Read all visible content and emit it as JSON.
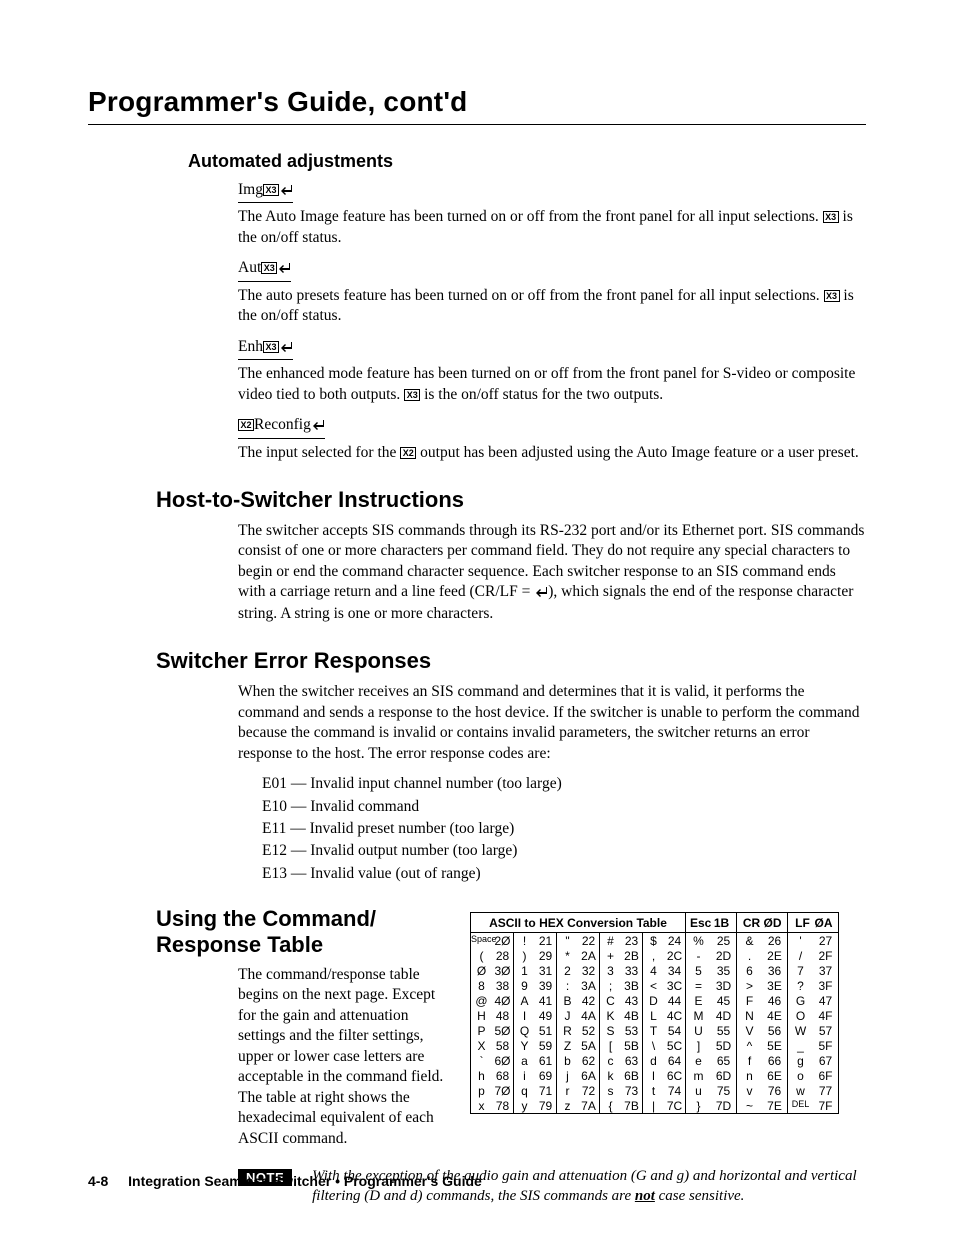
{
  "chapter_title": "Programmer's Guide, cont'd",
  "sections": {
    "automated": {
      "heading": "Automated adjustments",
      "img": {
        "label_prefix": "Img",
        "x_tag": "X3",
        "body_a": "The Auto Image feature has been turned on or off from the front panel for all input selections.  ",
        "body_b": " is the on/off status."
      },
      "aut": {
        "label_prefix": "Aut",
        "x_tag": "X3",
        "body_a": "The auto presets feature has been turned on or off from the front panel for all input selections.  ",
        "body_b": " is the on/off status."
      },
      "enh": {
        "label_prefix": "Enh",
        "x_tag": "X3",
        "body_a": "The enhanced mode feature has been turned on or off from the front panel for S-video or composite video tied to both outputs.  ",
        "body_b": " is the on/off status for the two outputs."
      },
      "reconfig": {
        "x_tag": "X2",
        "label_suffix": "Reconfig",
        "body_a": "The input selected for the ",
        "body_b": " output has been adjusted using the Auto Image feature or a user preset."
      }
    },
    "host": {
      "heading": "Host-to-Switcher Instructions",
      "body": "The switcher accepts SIS commands through its RS-232 port and/or its Ethernet port.  SIS commands consist of one or more characters per command field.  They do not require any special characters to begin or end the command character sequence.  Each switcher response to an SIS command ends with a carriage return and a line feed (CR/LF = ",
      "body_end": "), which signals the end of the response character string.  A string is one or more characters."
    },
    "errors": {
      "heading": "Switcher Error Responses",
      "body": "When the switcher receives an SIS command and determines that it is valid, it performs the command and sends a response to the host device.  If the switcher is unable to perform the command because the command is invalid or contains invalid parameters, the switcher returns an error response to the host.  The error response codes are:",
      "codes": [
        "E01 — Invalid input channel number (too large)",
        "E10 — Invalid command",
        "E11 — Invalid preset number (too large)",
        "E12 — Invalid output number (too large)",
        "E13 — Invalid value (out of range)"
      ]
    },
    "cmdresp": {
      "heading": "Using the Command/ Response Table",
      "body": "The command/response table begins on the next page.  Except for the gain and attenuation settings and the filter settings, upper or lower case letters are acceptable in the command field.  The table at right shows the hexadecimal equivalent of each ASCII command."
    }
  },
  "note": {
    "badge": "NOTE",
    "text_a": "With the exception of the audio gain and attenuation (G and g) and horizontal and vertical filtering (D and d) commands, the SIS commands are ",
    "under": "not",
    "text_b": " case sensitive."
  },
  "footer": {
    "page_num": "4-8",
    "title": "Integration Seamless Switcher • Programmer's Guide"
  },
  "chart_data": {
    "type": "table",
    "title": "ASCII to HEX  Conversion Table",
    "extra_headers": [
      {
        "ch": "Esc",
        "hex": "1B"
      },
      {
        "ch": "CR",
        "hex": "ØD"
      },
      {
        "ch": "LF",
        "hex": "ØA"
      }
    ],
    "columns": 8,
    "rows": [
      [
        [
          "Space",
          "2Ø"
        ],
        [
          "!",
          "21"
        ],
        [
          "\"",
          "22"
        ],
        [
          "#",
          "23"
        ],
        [
          "$",
          "24"
        ],
        [
          "%",
          "25"
        ],
        [
          "&",
          "26"
        ],
        [
          "'",
          "27"
        ]
      ],
      [
        [
          "(",
          "28"
        ],
        [
          ")",
          "29"
        ],
        [
          "*",
          "2A"
        ],
        [
          "+",
          "2B"
        ],
        [
          ",",
          "2C"
        ],
        [
          "-",
          "2D"
        ],
        [
          ".",
          "2E"
        ],
        [
          "/",
          "2F"
        ]
      ],
      [
        [
          "Ø",
          "3Ø"
        ],
        [
          "1",
          "31"
        ],
        [
          "2",
          "32"
        ],
        [
          "3",
          "33"
        ],
        [
          "4",
          "34"
        ],
        [
          "5",
          "35"
        ],
        [
          "6",
          "36"
        ],
        [
          "7",
          "37"
        ]
      ],
      [
        [
          "8",
          "38"
        ],
        [
          "9",
          "39"
        ],
        [
          ":",
          "3A"
        ],
        [
          ";",
          "3B"
        ],
        [
          "<",
          "3C"
        ],
        [
          "=",
          "3D"
        ],
        [
          ">",
          "3E"
        ],
        [
          "?",
          "3F"
        ]
      ],
      [
        [
          "@",
          "4Ø"
        ],
        [
          "A",
          "41"
        ],
        [
          "B",
          "42"
        ],
        [
          "C",
          "43"
        ],
        [
          "D",
          "44"
        ],
        [
          "E",
          "45"
        ],
        [
          "F",
          "46"
        ],
        [
          "G",
          "47"
        ]
      ],
      [
        [
          "H",
          "48"
        ],
        [
          "I",
          "49"
        ],
        [
          "J",
          "4A"
        ],
        [
          "K",
          "4B"
        ],
        [
          "L",
          "4C"
        ],
        [
          "M",
          "4D"
        ],
        [
          "N",
          "4E"
        ],
        [
          "O",
          "4F"
        ]
      ],
      [
        [
          "P",
          "5Ø"
        ],
        [
          "Q",
          "51"
        ],
        [
          "R",
          "52"
        ],
        [
          "S",
          "53"
        ],
        [
          "T",
          "54"
        ],
        [
          "U",
          "55"
        ],
        [
          "V",
          "56"
        ],
        [
          "W",
          "57"
        ]
      ],
      [
        [
          "X",
          "58"
        ],
        [
          "Y",
          "59"
        ],
        [
          "Z",
          "5A"
        ],
        [
          "[",
          "5B"
        ],
        [
          "\\",
          "5C"
        ],
        [
          "]",
          "5D"
        ],
        [
          "^",
          "5E"
        ],
        [
          "_",
          "5F"
        ]
      ],
      [
        [
          "`",
          "6Ø"
        ],
        [
          "a",
          "61"
        ],
        [
          "b",
          "62"
        ],
        [
          "c",
          "63"
        ],
        [
          "d",
          "64"
        ],
        [
          "e",
          "65"
        ],
        [
          "f",
          "66"
        ],
        [
          "g",
          "67"
        ]
      ],
      [
        [
          "h",
          "68"
        ],
        [
          "i",
          "69"
        ],
        [
          "j",
          "6A"
        ],
        [
          "k",
          "6B"
        ],
        [
          "l",
          "6C"
        ],
        [
          "m",
          "6D"
        ],
        [
          "n",
          "6E"
        ],
        [
          "o",
          "6F"
        ]
      ],
      [
        [
          "p",
          "7Ø"
        ],
        [
          "q",
          "71"
        ],
        [
          "r",
          "72"
        ],
        [
          "s",
          "73"
        ],
        [
          "t",
          "74"
        ],
        [
          "u",
          "75"
        ],
        [
          "v",
          "76"
        ],
        [
          "w",
          "77"
        ]
      ],
      [
        [
          "x",
          "78"
        ],
        [
          "y",
          "79"
        ],
        [
          "z",
          "7A"
        ],
        [
          "{",
          "7B"
        ],
        [
          "|",
          "7C"
        ],
        [
          "}",
          "7D"
        ],
        [
          "~",
          "7E"
        ],
        [
          "DEL",
          "7F"
        ]
      ]
    ]
  }
}
